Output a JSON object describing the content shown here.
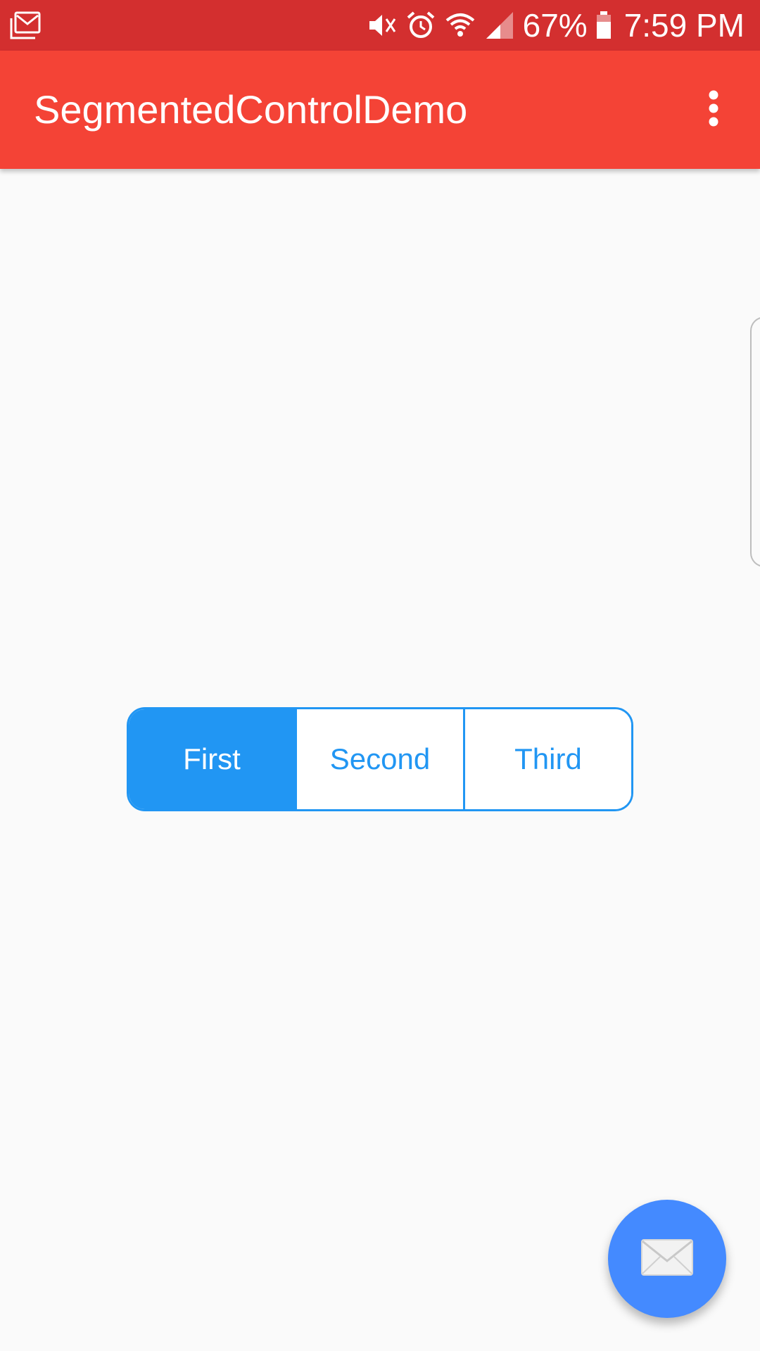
{
  "status_bar": {
    "left_icon": "gmail-icon",
    "icons": [
      "mute-icon",
      "alarm-icon",
      "wifi-icon",
      "signal-icon",
      "battery-icon"
    ],
    "battery_percent": "67%",
    "time": "7:59 PM"
  },
  "app_bar": {
    "title": "SegmentedControlDemo",
    "overflow_icon": "more-vert-icon"
  },
  "segmented_control": {
    "segments": [
      {
        "label": "First",
        "selected": true
      },
      {
        "label": "Second",
        "selected": false
      },
      {
        "label": "Third",
        "selected": false
      }
    ]
  },
  "fab": {
    "icon": "mail-icon"
  },
  "colors": {
    "status_bar": "#d32f2f",
    "app_bar": "#f44336",
    "accent": "#2196f3",
    "fab": "#448aff",
    "background": "#fafafa"
  }
}
